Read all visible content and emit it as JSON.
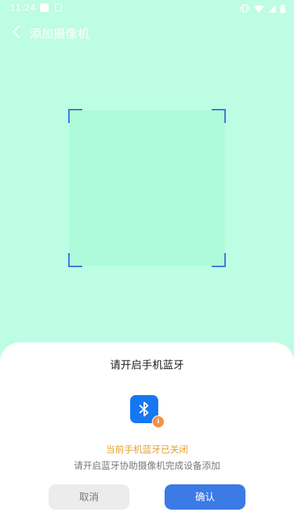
{
  "status_bar": {
    "time": "11:24",
    "icons": [
      "notification-square-icon",
      "image-icon",
      "vibrate-icon",
      "wifi-icon",
      "signal-icon",
      "battery-icon"
    ]
  },
  "header": {
    "back_icon": "chevron-left-icon",
    "title": "添加摄像机"
  },
  "dialog": {
    "title": "请开启手机蓝牙",
    "icon": "bluetooth-icon",
    "badge_icon": "info-icon",
    "badge_text": "i",
    "status": "当前手机蓝牙已关闭",
    "hint": "请开启蓝牙协助摄像机完成设备添加",
    "cancel_label": "取消",
    "confirm_label": "确认"
  },
  "colors": {
    "background": "#bcfde3",
    "scan_area": "#adfbd9",
    "scan_corner": "#3b6fd8",
    "bluetooth": "#1677f2",
    "warning": "#e6a02a",
    "badge": "#f29147",
    "primary_button": "#3c7ae6",
    "secondary_button": "#ececec"
  }
}
